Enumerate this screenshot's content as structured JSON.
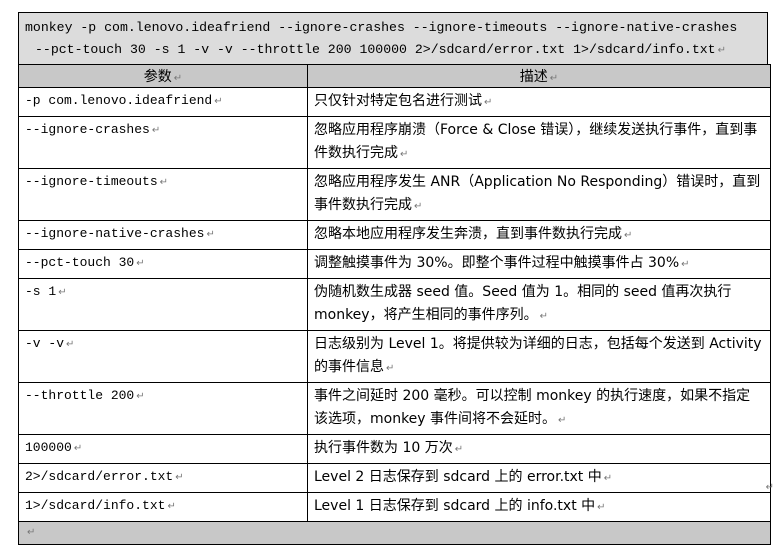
{
  "command": {
    "line1": "monkey -p com.lenovo.ideafriend --ignore-crashes --ignore-timeouts --ignore-native-crashes",
    "line2": "--pct-touch 30 -s 1 -v -v --throttle 200 100000 2>/sdcard/error.txt 1>/sdcard/info.txt"
  },
  "table": {
    "headers": [
      "参数",
      "描述"
    ],
    "rows": [
      {
        "param": "-p com.lenovo.ideafriend",
        "desc": "只仅针对特定包名进行测试"
      },
      {
        "param": "--ignore-crashes",
        "desc": "忽略应用程序崩溃（Force & Close 错误），继续发送执行事件，直到事件数执行完成"
      },
      {
        "param": "--ignore-timeouts",
        "desc": "忽略应用程序发生 ANR（Application No Responding）错误时，直到事件数执行完成"
      },
      {
        "param": "--ignore-native-crashes",
        "desc": "忽略本地应用程序发生奔溃，直到事件数执行完成"
      },
      {
        "param": "--pct-touch 30",
        "desc": "调整触摸事件为 30%。即整个事件过程中触摸事件占 30%"
      },
      {
        "param": "-s 1",
        "desc": "伪随机数生成器 seed 值。Seed 值为 1。相同的 seed 值再次执行 monkey，将产生相同的事件序列。"
      },
      {
        "param": "-v -v",
        "desc": "日志级别为 Level 1。将提供较为详细的日志，包括每个发送到 Activity 的事件信息"
      },
      {
        "param": "--throttle 200",
        "desc": "事件之间延时 200 毫秒。可以控制 monkey 的执行速度，如果不指定该选项，monkey 事件间将不会延时。"
      },
      {
        "param": "100000",
        "desc": "执行事件数为 10 万次"
      },
      {
        "param": "2>/sdcard/error.txt",
        "desc": "Level 2 日志保存到 sdcard 上的 error.txt 中"
      },
      {
        "param": "1>/sdcard/info.txt",
        "desc": "Level 1 日志保存到 sdcard 上的 info.txt 中"
      }
    ]
  },
  "paragraph_mark": "↵"
}
